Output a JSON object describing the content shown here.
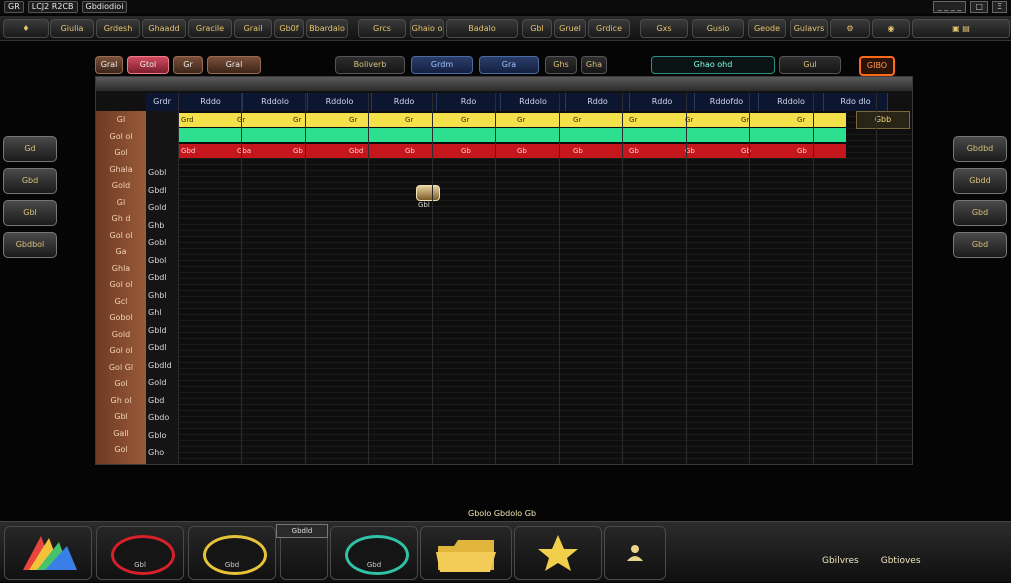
{
  "window": {
    "title_parts": [
      "GR",
      "LCJ2 R2CB",
      "Gbdiodioi"
    ],
    "controls": [
      "_ _ _ _",
      "□",
      "Ξ"
    ]
  },
  "toolbar": {
    "items": [
      "Giulia",
      "Grdesh",
      "Ghaadd",
      "Gracile",
      "Grail",
      "Gb0f",
      "Bbardalo",
      "Grcs",
      "Ghaio o",
      "Badalo",
      "Gbl",
      "Gruel",
      "Grdice",
      "Gxs",
      "Gusio",
      "Geode",
      "Gulavrs"
    ]
  },
  "tabs": {
    "items": [
      "Gral",
      "Gtol",
      "Gr",
      "Gral",
      "Boliverb",
      "Grdm",
      "Gra",
      "Ghs",
      "Gha",
      "Ghao ohd",
      "Gul",
      "GIBO"
    ]
  },
  "grid": {
    "columns": [
      "Grdr",
      "Rddo",
      "Rddolo",
      "Rddolo",
      "Rddo",
      "Rdo",
      "Rddolo",
      "Rddo",
      "Rddo",
      "Rddofdo",
      "Rddolo",
      "Rdo dlo"
    ],
    "row_labels": [
      "Gl",
      "Gol ol",
      "Gol",
      "Ghala",
      "Gold",
      "Gl",
      "Gh d",
      "Gol ol",
      "Ga",
      "Ghla",
      "Gol ol",
      "Gcl",
      "Gobol",
      "Gold",
      "Gol ol",
      "Gol Gl",
      "Gol",
      "Gh ol",
      "Gbl",
      "Gall",
      "Gol"
    ],
    "sub_labels": [
      "Gobl",
      "Gbdl",
      "Gold",
      "Ghb",
      "Gobl",
      "Gbol",
      "Gbdl",
      "Ghbl",
      "Ghl",
      "Gbld",
      "Gbdl",
      "Gbdld",
      "Gold",
      "Gbd",
      "Gbdo",
      "Gblo",
      "Gho"
    ],
    "side_label": "Gbb",
    "chip_label": "Gbl",
    "yellow_row": [
      "Grd",
      "Gr",
      "Gr",
      "Gr",
      "Gr",
      "Gr",
      "Gr",
      "Gr",
      "Gr",
      "Gr",
      "Gr",
      "Gr"
    ],
    "red_row": [
      "Gbd",
      "Gba",
      "Gb",
      "Gbd",
      "Gb",
      "Gb",
      "Gb",
      "Gb",
      "Gb",
      "Gb",
      "Gb",
      "Gb"
    ]
  },
  "side_buttons": {
    "left": [
      "Gd",
      "Gbd",
      "Gbl",
      "Gbdbol"
    ],
    "right": [
      "Gbdbd",
      "Gbdd",
      "Gbd",
      "Gbd"
    ]
  },
  "status": {
    "text": "Gbolo Gbdolo Gb"
  },
  "bottom": {
    "tag": "Gbdld",
    "ring_labels": [
      "Gbl",
      "Gbd",
      "Gbd"
    ],
    "right": [
      "Gbilvres",
      "Gbtioves"
    ]
  },
  "colors": {
    "yellow_band": "#f3e04a",
    "green_band": "#2ce08f",
    "red_band": "#c4161c",
    "ring_red": "#d6202a",
    "ring_gold": "#e7c33a",
    "ring_teal": "#2fc2a6"
  }
}
